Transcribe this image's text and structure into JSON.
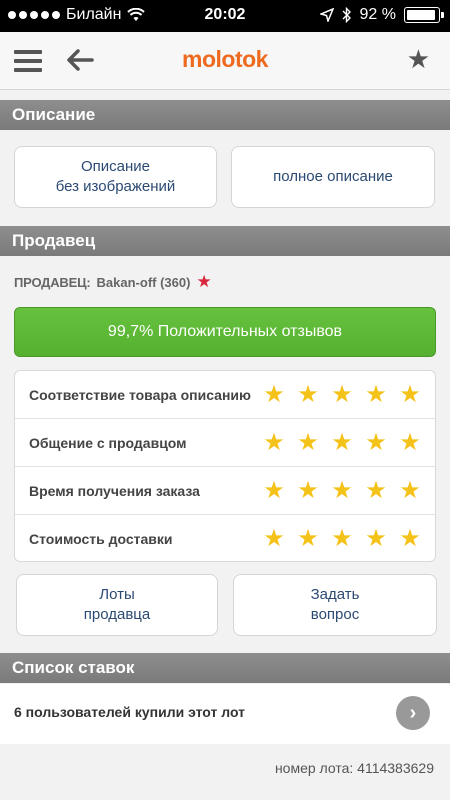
{
  "status_bar": {
    "carrier": "Билайн",
    "time": "20:02",
    "battery": "92 %",
    "battery_level": 0.92
  },
  "navbar": {
    "logo": "molotok",
    "logo_color": "#ee6a1e"
  },
  "description_section": {
    "title": "Описание",
    "button_no_images": "Описание\nбез изображений",
    "button_full": "полное описание"
  },
  "seller_section": {
    "title": "Продавец",
    "seller_label": "ПРОДАВЕЦ:",
    "seller_name": "Bakan-off (360)",
    "positive_feedback": "99,7% Положительных отзывов",
    "ratings": [
      {
        "label": "Соответствие товара описанию",
        "stars": 5
      },
      {
        "label": "Общение с продавцом",
        "stars": 5
      },
      {
        "label": "Время получения заказа",
        "stars": 5
      },
      {
        "label": "Стоимость доставки",
        "stars": 5
      }
    ],
    "button_lots": "Лоты\nпродавца",
    "button_ask": "Задать\nвопрос"
  },
  "bids_section": {
    "title": "Список ставок",
    "buyers_text": "6 пользователей купили этот лот",
    "lot_number": "номер лота: 4114383629"
  }
}
